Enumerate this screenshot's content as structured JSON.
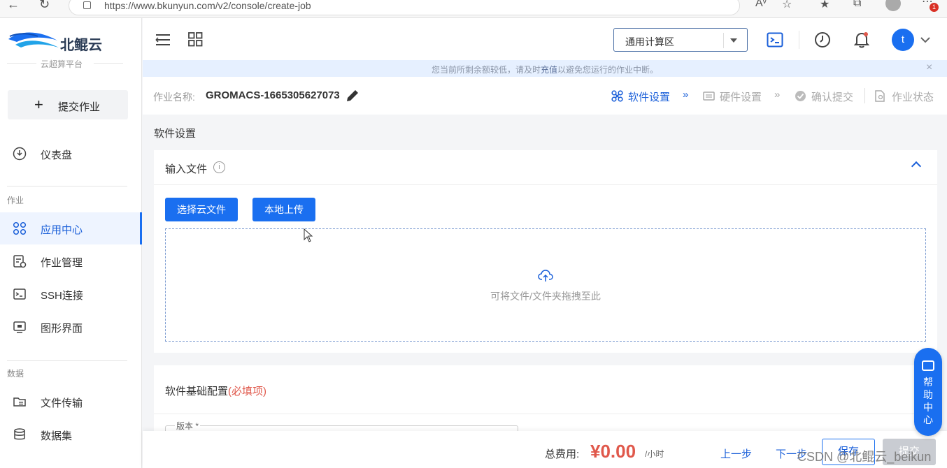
{
  "browser": {
    "url": "https://www.bkunyun.com/v2/console/create-job"
  },
  "sidebar": {
    "logo_text": "北鲲云",
    "logo_sub": "云超算平台",
    "submit_label": "提交作业",
    "items": [
      {
        "label": "仪表盘"
      },
      {
        "label": "应用中心"
      },
      {
        "label": "作业管理"
      },
      {
        "label": "SSH连接"
      },
      {
        "label": "图形界面"
      },
      {
        "label": "文件传输"
      },
      {
        "label": "数据集"
      }
    ],
    "sections": [
      "作业",
      "数据"
    ]
  },
  "topbar": {
    "zone_value": "通用计算区",
    "user_initial": "t"
  },
  "notice": {
    "before": "您当前所剩余额较低，请及时",
    "link": "充值",
    "after": "以避免您运行的作业中断。",
    "close": "×"
  },
  "job": {
    "name_label": "作业名称:",
    "name_value": "GROMACS-1665305627073",
    "steps": [
      "软件设置",
      "硬件设置",
      "确认提交",
      "作业状态"
    ]
  },
  "main": {
    "title": "软件设置",
    "input_files": {
      "title": "输入文件",
      "choose_cloud_label": "选择云文件",
      "local_upload_label": "本地上传",
      "drop_hint": "可将文件/文件夹拖拽至此"
    },
    "basic_config": {
      "title": "软件基础配置",
      "required": "(必填项)",
      "version_label": "版本 *"
    }
  },
  "bottom": {
    "total_label": "总费用:",
    "price": "¥0.00",
    "unit": "/小时",
    "prev_label": "上一步",
    "next_label": "下一步",
    "save_label": "保存",
    "submit_label": "提交"
  },
  "help": {
    "label": "帮助中心"
  },
  "watermark": "CSDN @北鲲云_beikun",
  "colors": {
    "primary": "#1a6ff0",
    "price": "#e0584b",
    "notice_bg": "#e6f0ff"
  }
}
